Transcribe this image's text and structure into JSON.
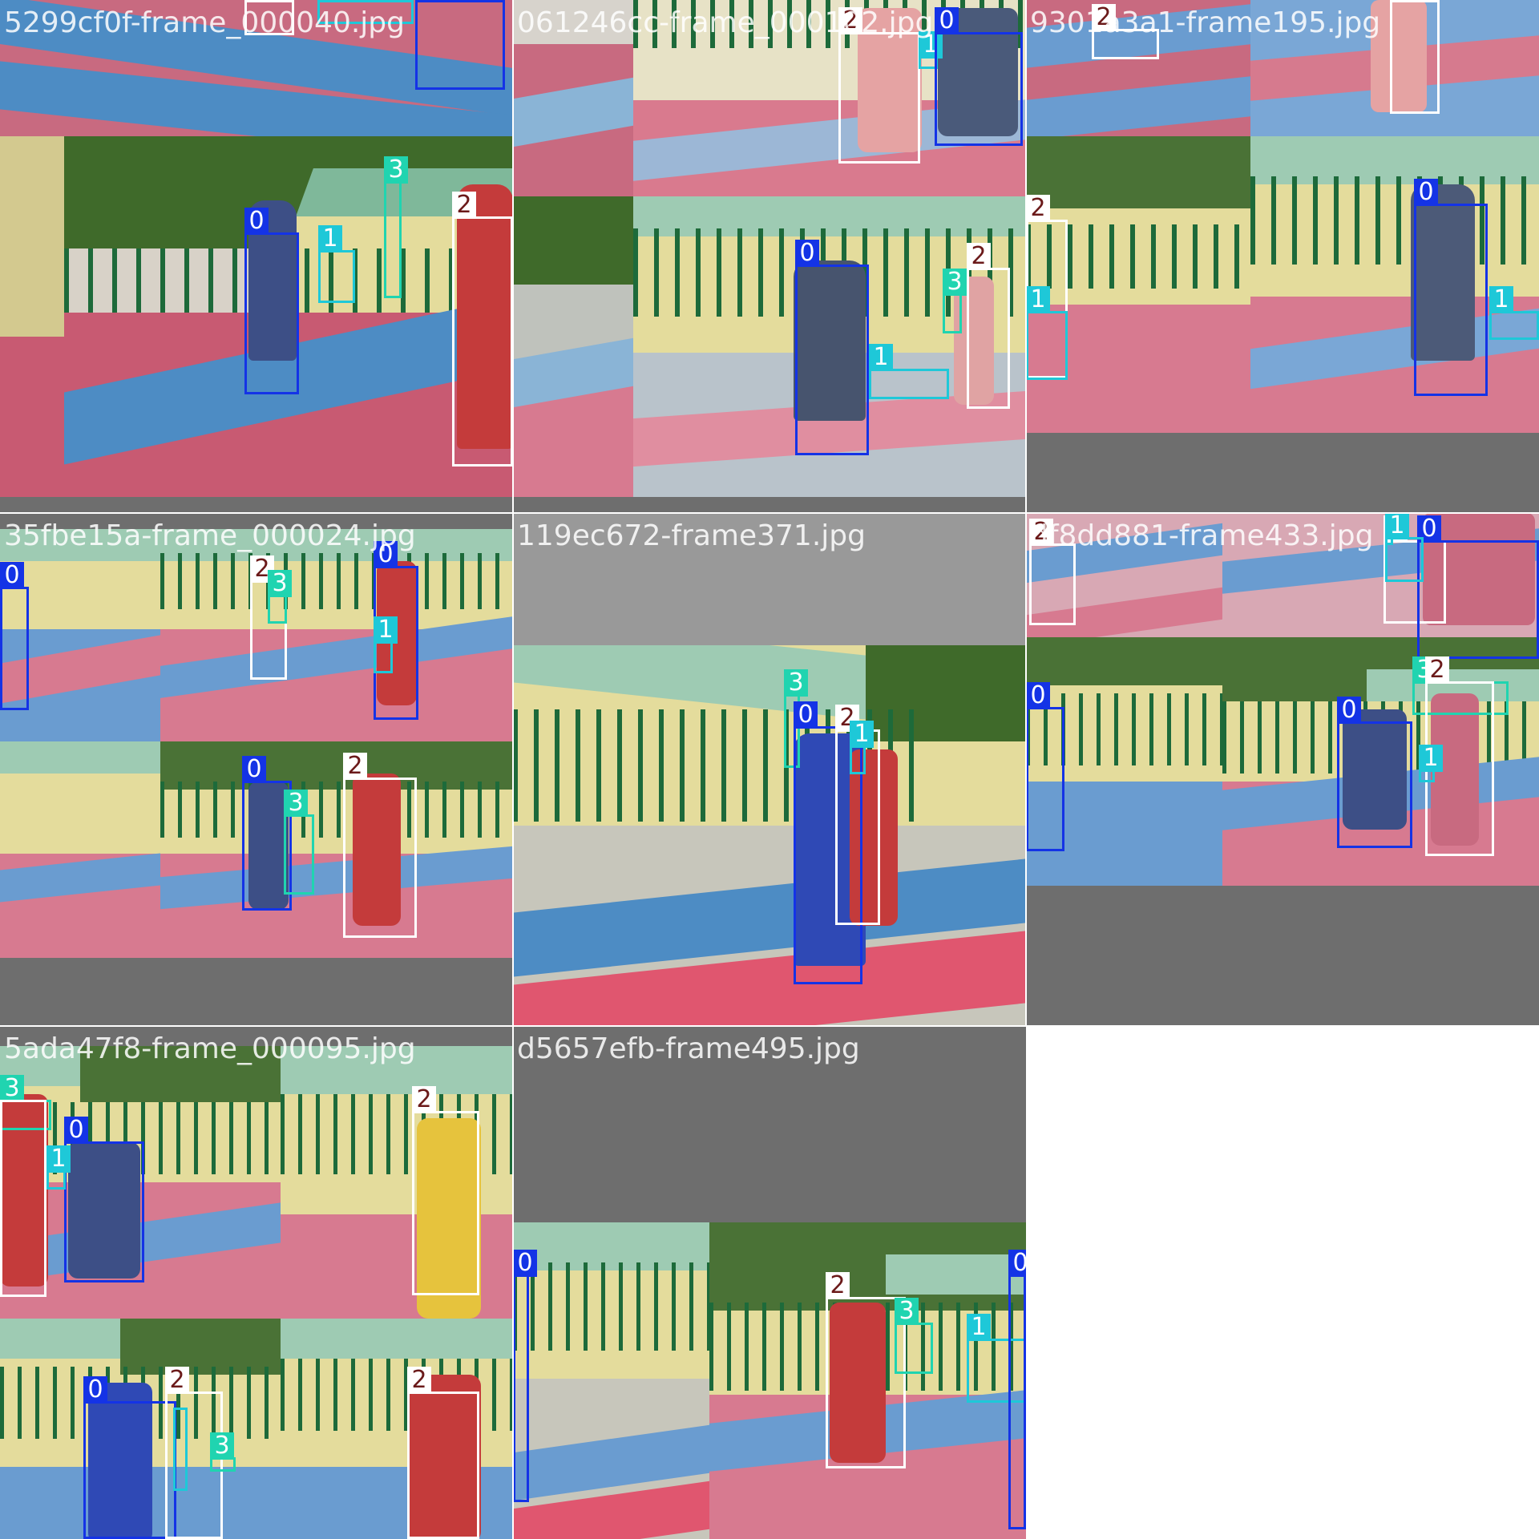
{
  "grid": {
    "tiles": [
      {
        "filename": "5299cf0f-frame_000040.jpg"
      },
      {
        "filename": "061246cc-frame_000102.jpg"
      },
      {
        "filename": "9301a3a1-frame195.jpg"
      },
      {
        "filename": "35fbe15a-frame_000024.jpg"
      },
      {
        "filename": "119ec672-frame371.jpg"
      },
      {
        "filename": "df8dd881-frame433.jpg"
      },
      {
        "filename": "5ada47f8-frame_000095.jpg"
      },
      {
        "filename": "d5657efb-frame495.jpg"
      }
    ]
  },
  "classes": {
    "c0": {
      "label": "0",
      "color": "#1433e6"
    },
    "c1": {
      "label": "1",
      "color": "#1ec8d8"
    },
    "c2": {
      "label": "2",
      "color": "#ffffff"
    },
    "c3": {
      "label": "3",
      "color": "#20d4b0"
    }
  },
  "labels": {
    "l0": "0",
    "l1": "1",
    "l2": "2",
    "l3": "3"
  }
}
